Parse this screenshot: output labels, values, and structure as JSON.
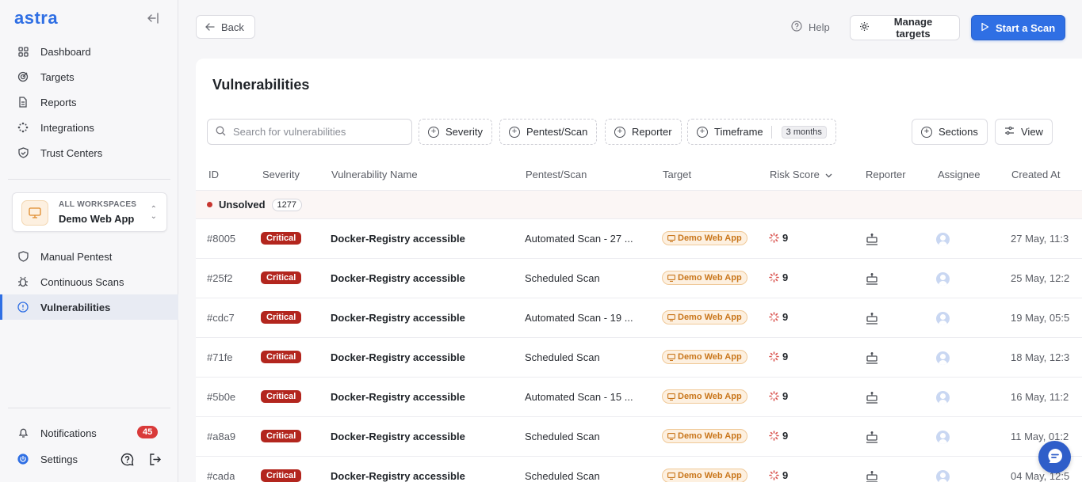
{
  "app": {
    "logo": "astra"
  },
  "sidebar": {
    "nav": [
      {
        "label": "Dashboard",
        "icon": "grid-icon"
      },
      {
        "label": "Targets",
        "icon": "target-icon"
      },
      {
        "label": "Reports",
        "icon": "document-icon"
      },
      {
        "label": "Integrations",
        "icon": "integrations-icon"
      },
      {
        "label": "Trust Centers",
        "icon": "shield-icon"
      }
    ],
    "workspace": {
      "label": "ALL WORKSPACES",
      "name": "Demo Web App"
    },
    "nav2": [
      {
        "label": "Manual Pentest",
        "icon": "shield-icon"
      },
      {
        "label": "Continuous Scans",
        "icon": "bug-icon"
      },
      {
        "label": "Vulnerabilities",
        "icon": "alert-icon",
        "active": true
      }
    ],
    "notifications": {
      "label": "Notifications",
      "count": "45"
    },
    "settings": {
      "label": "Settings"
    }
  },
  "topbar": {
    "back": "Back",
    "help": "Help",
    "manage_targets": "Manage targets",
    "start_scan": "Start a Scan"
  },
  "page": {
    "title": "Vulnerabilities",
    "search_placeholder": "Search for vulnerabilities",
    "filters": {
      "severity": "Severity",
      "pentest": "Pentest/Scan",
      "reporter": "Reporter",
      "timeframe": "Timeframe",
      "timeframe_value": "3 months"
    },
    "sections": "Sections",
    "view": "View"
  },
  "table": {
    "columns": {
      "id": "ID",
      "severity": "Severity",
      "name": "Vulnerability Name",
      "scan": "Pentest/Scan",
      "target": "Target",
      "risk": "Risk Score",
      "reporter": "Reporter",
      "assignee": "Assignee",
      "created": "Created At"
    },
    "group": {
      "label": "Unsolved",
      "count": "1277"
    },
    "rows": [
      {
        "id": "#8005",
        "severity": "Critical",
        "name": "Docker-Registry accessible",
        "scan": "Automated Scan - 27 ...",
        "target": "Demo Web App",
        "risk": "9",
        "created": "27 May, 11:3"
      },
      {
        "id": "#25f2",
        "severity": "Critical",
        "name": "Docker-Registry accessible",
        "scan": "Scheduled Scan",
        "target": "Demo Web App",
        "risk": "9",
        "created": "25 May, 12:2"
      },
      {
        "id": "#cdc7",
        "severity": "Critical",
        "name": "Docker-Registry accessible",
        "scan": "Automated Scan - 19 ...",
        "target": "Demo Web App",
        "risk": "9",
        "created": "19 May, 05:5"
      },
      {
        "id": "#71fe",
        "severity": "Critical",
        "name": "Docker-Registry accessible",
        "scan": "Scheduled Scan",
        "target": "Demo Web App",
        "risk": "9",
        "created": "18 May, 12:3"
      },
      {
        "id": "#5b0e",
        "severity": "Critical",
        "name": "Docker-Registry accessible",
        "scan": "Automated Scan - 15 ...",
        "target": "Demo Web App",
        "risk": "9",
        "created": "16 May, 11:2"
      },
      {
        "id": "#a8a9",
        "severity": "Critical",
        "name": "Docker-Registry accessible",
        "scan": "Scheduled Scan",
        "target": "Demo Web App",
        "risk": "9",
        "created": "11 May, 01:2"
      },
      {
        "id": "#cada",
        "severity": "Critical",
        "name": "Docker-Registry accessible",
        "scan": "Scheduled Scan",
        "target": "Demo Web App",
        "risk": "9",
        "created": "04 May, 12:5"
      }
    ]
  },
  "colors": {
    "accent": "#2f6fe4",
    "critical": "#b3261e",
    "target_badge": "#c9761b",
    "notif_badge": "#d93a3a"
  }
}
